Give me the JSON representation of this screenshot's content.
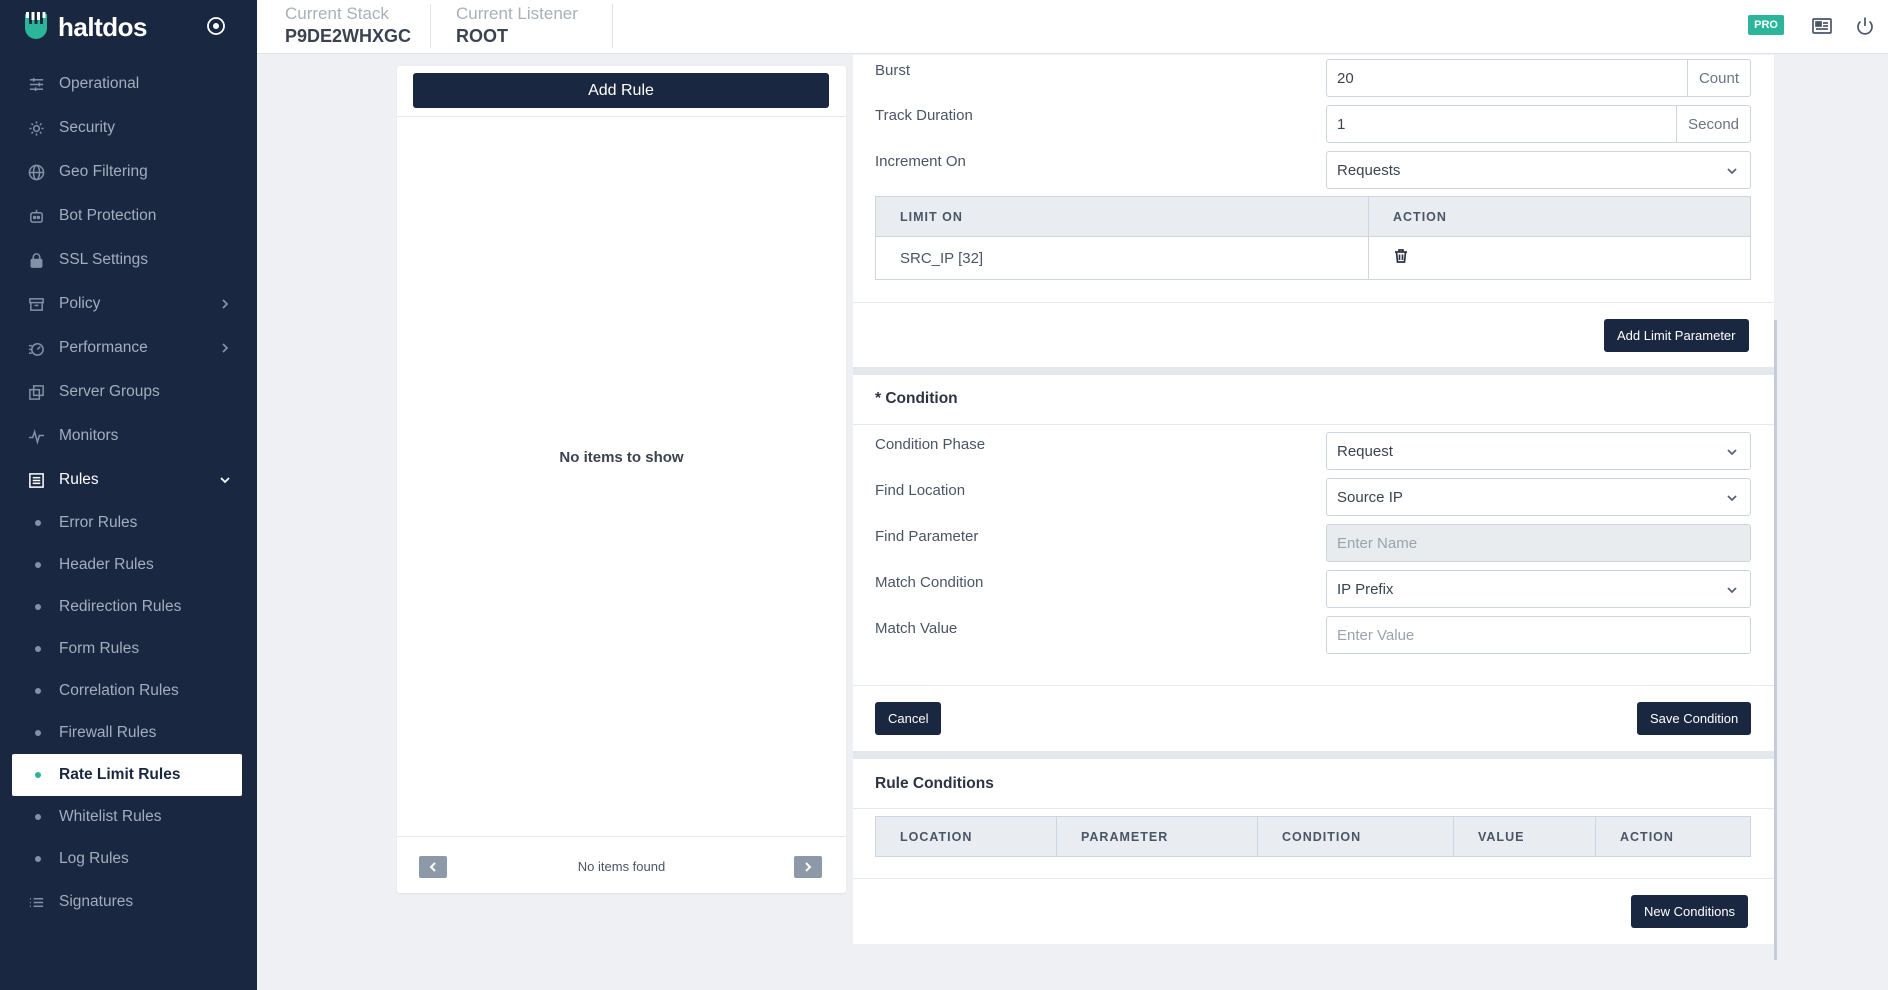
{
  "brand": {
    "name": "haltdos"
  },
  "sidebar": {
    "items": [
      {
        "label": "Operational",
        "icon": "sliders-icon"
      },
      {
        "label": "Security",
        "icon": "gear-icon"
      },
      {
        "label": "Geo Filtering",
        "icon": "globe-icon"
      },
      {
        "label": "Bot Protection",
        "icon": "bot-icon"
      },
      {
        "label": "SSL Settings",
        "icon": "lock-icon"
      },
      {
        "label": "Policy",
        "icon": "archive-icon"
      },
      {
        "label": "Performance",
        "icon": "speed-icon"
      },
      {
        "label": "Server Groups",
        "icon": "copy-icon"
      },
      {
        "label": "Monitors",
        "icon": "pulse-icon"
      },
      {
        "label": "Rules",
        "icon": "list-icon"
      }
    ],
    "rules_sub": [
      "Error Rules",
      "Header Rules",
      "Redirection Rules",
      "Form Rules",
      "Correlation Rules",
      "Firewall Rules",
      "Rate Limit Rules",
      "Whitelist Rules",
      "Log Rules"
    ],
    "signatures": "Signatures"
  },
  "topbar": {
    "stack_label": "Current Stack",
    "stack_value": "P9DE2WHXGC",
    "listener_label": "Current Listener",
    "listener_value": "ROOT",
    "badge": "PRO"
  },
  "list": {
    "add_rule": "Add Rule",
    "empty": "No items to show",
    "footer": "No items found"
  },
  "limit": {
    "burst_label": "Burst",
    "burst_value": "20",
    "burst_unit": "Count",
    "track_label": "Track Duration",
    "track_value": "1",
    "track_unit": "Second",
    "increment_label": "Increment On",
    "increment_value": "Requests",
    "table_headers": [
      "LIMIT ON",
      "ACTION"
    ],
    "rows": [
      {
        "limit_on": "SRC_IP [32]"
      }
    ],
    "add_param": "Add Limit Parameter"
  },
  "condition": {
    "title": "* Condition",
    "phase_label": "Condition Phase",
    "phase_value": "Request",
    "location_label": "Find Location",
    "location_value": "Source IP",
    "param_label": "Find Parameter",
    "param_placeholder": "Enter Name",
    "match_label": "Match Condition",
    "match_value": "IP Prefix",
    "value_label": "Match Value",
    "value_placeholder": "Enter Value",
    "cancel": "Cancel",
    "save": "Save Condition"
  },
  "rule_conditions": {
    "title": "Rule Conditions",
    "headers": [
      "LOCATION",
      "PARAMETER",
      "CONDITION",
      "VALUE",
      "ACTION"
    ],
    "new": "New Conditions"
  }
}
